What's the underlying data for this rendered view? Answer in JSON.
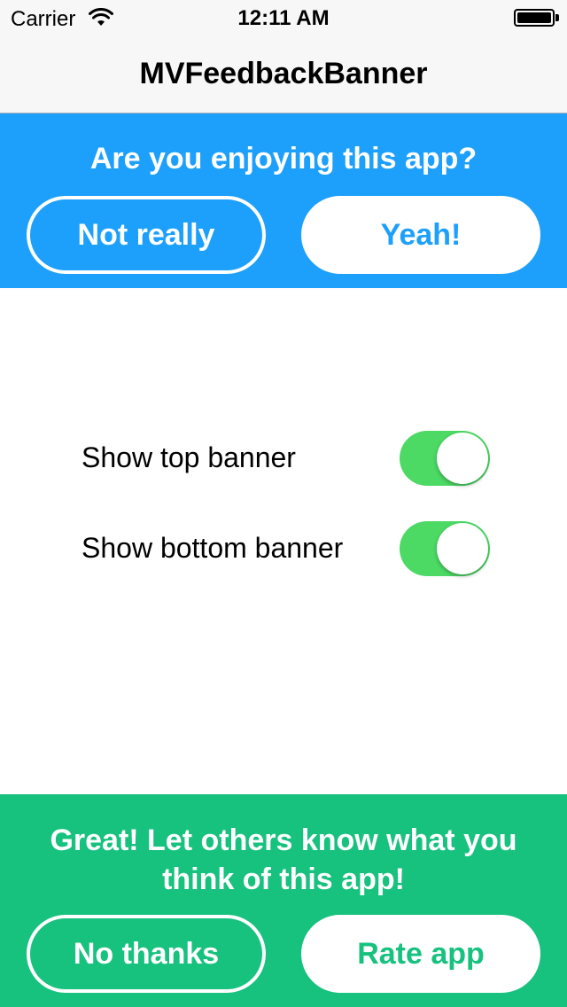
{
  "status_bar": {
    "carrier": "Carrier",
    "time": "12:11 AM",
    "wifi_icon": "wifi-icon",
    "battery_icon": "battery-icon"
  },
  "nav": {
    "title": "MVFeedbackBanner"
  },
  "top_banner": {
    "question": "Are you enjoying this app?",
    "negative_label": "Not really",
    "positive_label": "Yeah!",
    "background_color": "#1ca0fb"
  },
  "settings": {
    "rows": [
      {
        "label": "Show top banner",
        "on": true
      },
      {
        "label": "Show bottom banner",
        "on": true
      }
    ],
    "switch_on_color": "#4cd964"
  },
  "bottom_banner": {
    "message": "Great! Let others know what you think of this app!",
    "negative_label": "No thanks",
    "positive_label": "Rate app",
    "background_color": "#17c17e"
  }
}
